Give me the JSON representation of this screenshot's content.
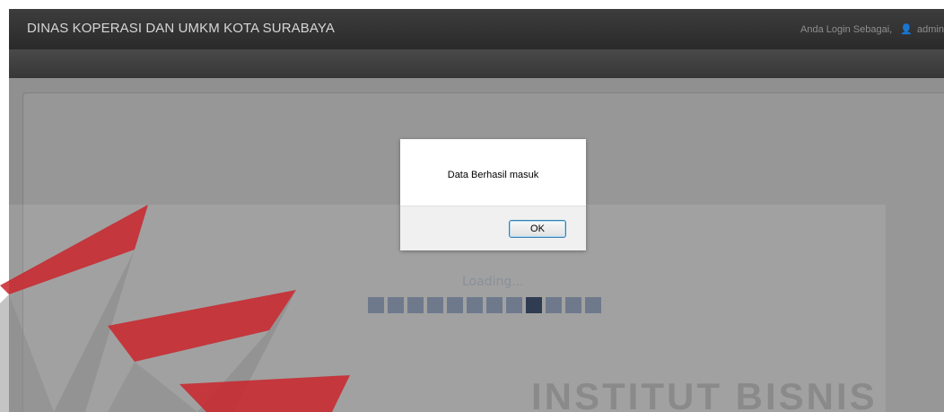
{
  "header": {
    "title": "DINAS KOPERASI DAN UMKM KOTA SURABAYA",
    "login_prefix": "Anda Login Sebagai,",
    "user_icon": "user-icon",
    "user_name": "admin"
  },
  "loading": {
    "label": "Loading...",
    "block_count": 12,
    "active_index": 8
  },
  "dialog": {
    "message": "Data Berhasil masuk",
    "ok_label": "OK"
  },
  "watermark": {
    "text": "INSTITUT BISNIS"
  },
  "colors": {
    "topbar": "#333333",
    "watermark_red": "#c9252c",
    "button_border": "#3c7fb1"
  }
}
